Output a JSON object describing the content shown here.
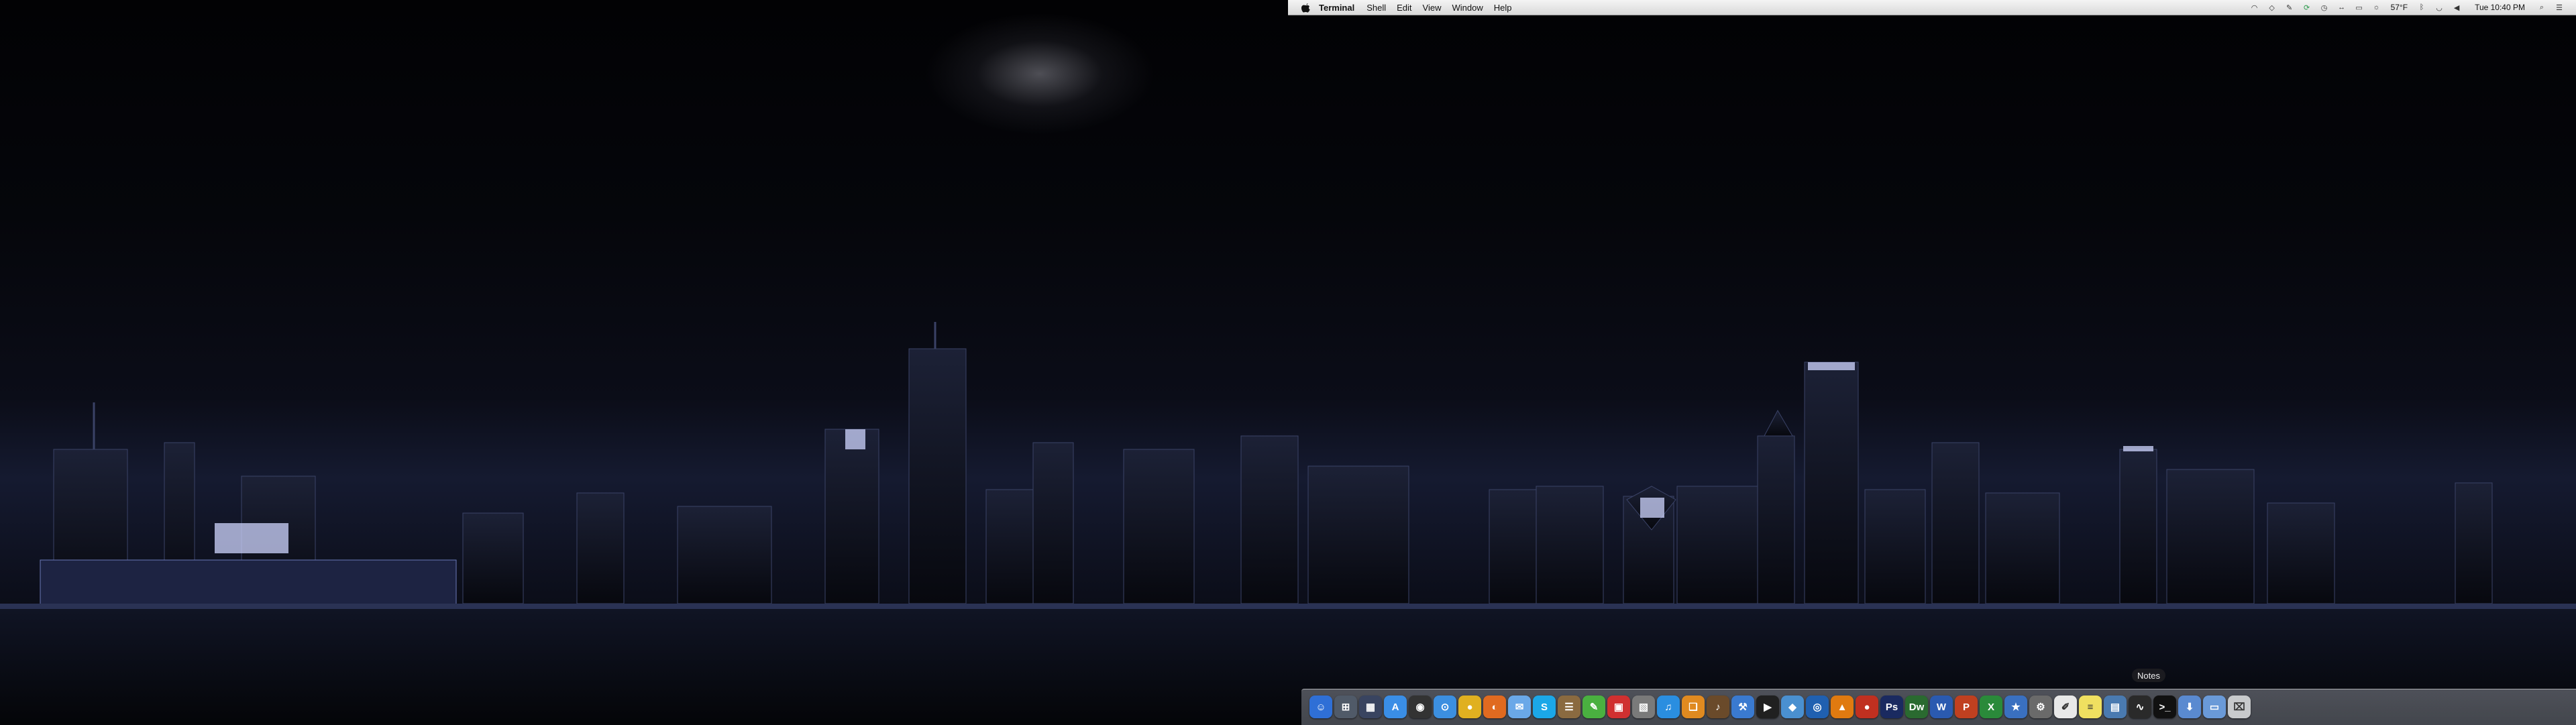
{
  "menubar": {
    "app_name": "Terminal",
    "menus": [
      "Shell",
      "Edit",
      "View",
      "Window",
      "Help"
    ],
    "temperature": "57°F",
    "clock": "Tue 10:40 PM"
  },
  "dock": {
    "tooltip": "Notes",
    "icons": [
      {
        "name": "finder-icon",
        "color": "#2f6fd6",
        "glyph": "☺"
      },
      {
        "name": "launchpad-icon",
        "color": "#505a68",
        "glyph": "⊞"
      },
      {
        "name": "mission-control-icon",
        "color": "#394460",
        "glyph": "▦"
      },
      {
        "name": "app-store-icon",
        "color": "#3a8ee6",
        "glyph": "A"
      },
      {
        "name": "dashboard-icon",
        "color": "#333333",
        "glyph": "◉"
      },
      {
        "name": "safari-icon",
        "color": "#3c8fe0",
        "glyph": "⊙"
      },
      {
        "name": "chrome-icon",
        "color": "#e0b020",
        "glyph": "●"
      },
      {
        "name": "firefox-icon",
        "color": "#e06a20",
        "glyph": "◐"
      },
      {
        "name": "mail-icon",
        "color": "#6aa8e8",
        "glyph": "✉"
      },
      {
        "name": "skype-icon",
        "color": "#1ba7e8",
        "glyph": "S"
      },
      {
        "name": "contacts-icon",
        "color": "#8a6a40",
        "glyph": "☰"
      },
      {
        "name": "evernote-icon",
        "color": "#4ab040",
        "glyph": "✎"
      },
      {
        "name": "calendar-icon",
        "color": "#d03030",
        "glyph": "▣"
      },
      {
        "name": "photos-icon",
        "color": "#7a7a7a",
        "glyph": "▧"
      },
      {
        "name": "itunes-icon",
        "color": "#2a8ee0",
        "glyph": "♫"
      },
      {
        "name": "ibooks-icon",
        "color": "#e08a20",
        "glyph": "❑"
      },
      {
        "name": "garageband-icon",
        "color": "#6a4a2a",
        "glyph": "♪"
      },
      {
        "name": "xcode-icon",
        "color": "#3a7ad0",
        "glyph": "⚒"
      },
      {
        "name": "terminal-tool-icon",
        "color": "#202020",
        "glyph": "▶"
      },
      {
        "name": "sequel-icon",
        "color": "#4a90d0",
        "glyph": "◆"
      },
      {
        "name": "network-icon",
        "color": "#2060b0",
        "glyph": "◎"
      },
      {
        "name": "vlc-icon",
        "color": "#e07a10",
        "glyph": "▲"
      },
      {
        "name": "transmission-icon",
        "color": "#c03020",
        "glyph": "●"
      },
      {
        "name": "photoshop-icon",
        "color": "#1a2a60",
        "glyph": "Ps"
      },
      {
        "name": "dreamweaver-icon",
        "color": "#2a6a30",
        "glyph": "Dw"
      },
      {
        "name": "word-icon",
        "color": "#2a5ab0",
        "glyph": "W"
      },
      {
        "name": "powerpoint-icon",
        "color": "#c04020",
        "glyph": "P"
      },
      {
        "name": "excel-icon",
        "color": "#2a8a3a",
        "glyph": "X"
      },
      {
        "name": "wunderlist-icon",
        "color": "#3a70c0",
        "glyph": "★"
      },
      {
        "name": "system-preferences-icon",
        "color": "#6a6a6a",
        "glyph": "⚙"
      },
      {
        "name": "textedit-icon",
        "color": "#e8e8e8",
        "glyph": "✐"
      },
      {
        "name": "notes-icon",
        "color": "#f0e060",
        "glyph": "≡"
      },
      {
        "name": "preview-icon",
        "color": "#4a7ab0",
        "glyph": "▤"
      },
      {
        "name": "activity-monitor-icon",
        "color": "#2a2a2a",
        "glyph": "∿"
      },
      {
        "name": "terminal-icon",
        "color": "#111111",
        "glyph": ">_"
      },
      {
        "name": "downloads-folder-icon",
        "color": "#5a8ad0",
        "glyph": "⬇"
      },
      {
        "name": "documents-folder-icon",
        "color": "#6a9ad8",
        "glyph": "▭"
      },
      {
        "name": "trash-icon",
        "color": "#c8cacc",
        "glyph": "⌧"
      }
    ]
  }
}
